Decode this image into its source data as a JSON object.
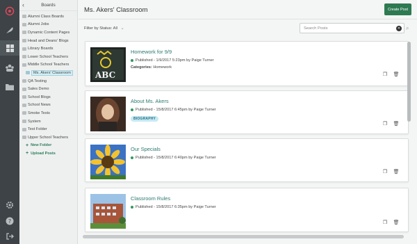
{
  "sidebar": {
    "title": "Boards",
    "items": [
      {
        "label": "Alumni Class Boards"
      },
      {
        "label": "Alumni Jobs"
      },
      {
        "label": "Dynamic Content Pages"
      },
      {
        "label": "Head and Deans' Blogs"
      },
      {
        "label": "Library Boards"
      },
      {
        "label": "Lower School Teachers"
      },
      {
        "label": "Middle School Teachers"
      },
      {
        "label": "Ms. Akers' Classroom"
      },
      {
        "label": "QA Testing"
      },
      {
        "label": "Sales Demo"
      },
      {
        "label": "School Blogs"
      },
      {
        "label": "School News"
      },
      {
        "label": "Smoke Tests"
      },
      {
        "label": "System"
      },
      {
        "label": "Test Folder"
      },
      {
        "label": "Upper School Teachers"
      }
    ],
    "new_folder": "New Folder",
    "upload_posts": "Upload Posts"
  },
  "header": {
    "title": "Ms. Akers' Classroom",
    "create_button": "Create Post"
  },
  "filter": {
    "label": "Filter by Status:",
    "value": "All"
  },
  "search": {
    "placeholder": "Search Posts"
  },
  "posts": [
    {
      "title": "Homework for 9/9",
      "meta": "Published -  1/9/2017 5:23pm by Paige Turner",
      "categories_label": "Categories:",
      "categories_value": "Homework"
    },
    {
      "title": "About Ms. Akers",
      "meta": "Published -  15/8/2017 6:45pm by Paige Turner",
      "badge": "BIOGRAPHY"
    },
    {
      "title": "Our Specials",
      "meta": "Published -  15/8/2017 6:40pm by Paige Turner"
    },
    {
      "title": "Classroom Rules",
      "meta": "Published -  15/8/2017 6:35pm by Paige Turner"
    }
  ],
  "colors": {
    "accent": "#2e7a52",
    "link": "#2d7a6e",
    "published_dot": "#2e9a5c",
    "badge_bg": "#c7eaf3"
  }
}
